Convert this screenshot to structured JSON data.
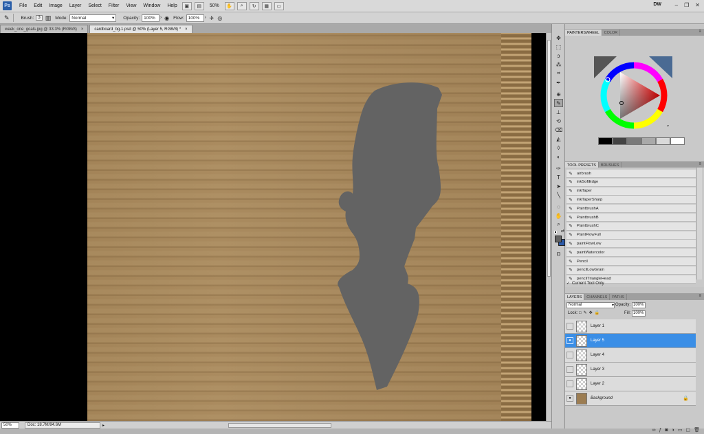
{
  "app": {
    "logo": "Ps",
    "menus": [
      "File",
      "Edit",
      "Image",
      "Layer",
      "Select",
      "Filter",
      "View",
      "Window",
      "Help"
    ],
    "zoom": "50%",
    "workspace": "DW"
  },
  "options": {
    "brush_label": "Brush:",
    "brush_size": "3",
    "mode_label": "Mode:",
    "mode_value": "Normal",
    "opacity_label": "Opacity:",
    "opacity_value": "100%",
    "flow_label": "Flow:",
    "flow_value": "100%"
  },
  "tabs": [
    {
      "label": "week_one_goals.jpg @ 33.3% (RGB/8)",
      "active": false
    },
    {
      "label": "cardboard_bg.1.psd @ 50% (Layer 5, RGB/8) *",
      "active": true
    }
  ],
  "status": {
    "zoom": "50%",
    "doc": "Doc: 18.7M/94.6M"
  },
  "panels": {
    "color_tabs": [
      "PAINTERSWHEEL",
      "COLOR"
    ],
    "presets_tabs": [
      "TOOL PRESETS",
      "BRUSHES"
    ],
    "layers_tabs": [
      "LAYERS",
      "CHANNELS",
      "PATHS"
    ]
  },
  "swatches": [
    "#000000",
    "#444444",
    "#7a7a7a",
    "#a9a9a9",
    "#d9d9d9",
    "#ffffff"
  ],
  "presets": [
    "airbrush",
    "inkSoftEdge",
    "inkTaper",
    "inkTaperSharp",
    "PaintbrushA",
    "PaintbrushB",
    "PaintbrushC",
    "PaintFlowFull",
    "paintFlowLow",
    "paintWatercolor",
    "Pencil",
    "pencilLowGrain",
    "pencilTriangleHead"
  ],
  "preset_footer": "Current Tool Only",
  "layers": {
    "blend_mode": "Normal",
    "opacity_label": "Opacity:",
    "opacity_value": "100%",
    "lock_label": "Lock:",
    "fill_label": "Fill:",
    "fill_value": "100%",
    "items": [
      {
        "name": "Layer 1",
        "visible": false,
        "selected": false
      },
      {
        "name": "Layer 5",
        "visible": true,
        "selected": true
      },
      {
        "name": "Layer 4",
        "visible": false,
        "selected": false
      },
      {
        "name": "Layer 3",
        "visible": false,
        "selected": false
      },
      {
        "name": "Layer 2",
        "visible": false,
        "selected": false
      },
      {
        "name": "Background",
        "visible": true,
        "selected": false,
        "locked": true
      }
    ]
  },
  "colors": {
    "silhouette": "#636363",
    "accent": "#3a8ee6",
    "cardboard": "#a8895d"
  }
}
